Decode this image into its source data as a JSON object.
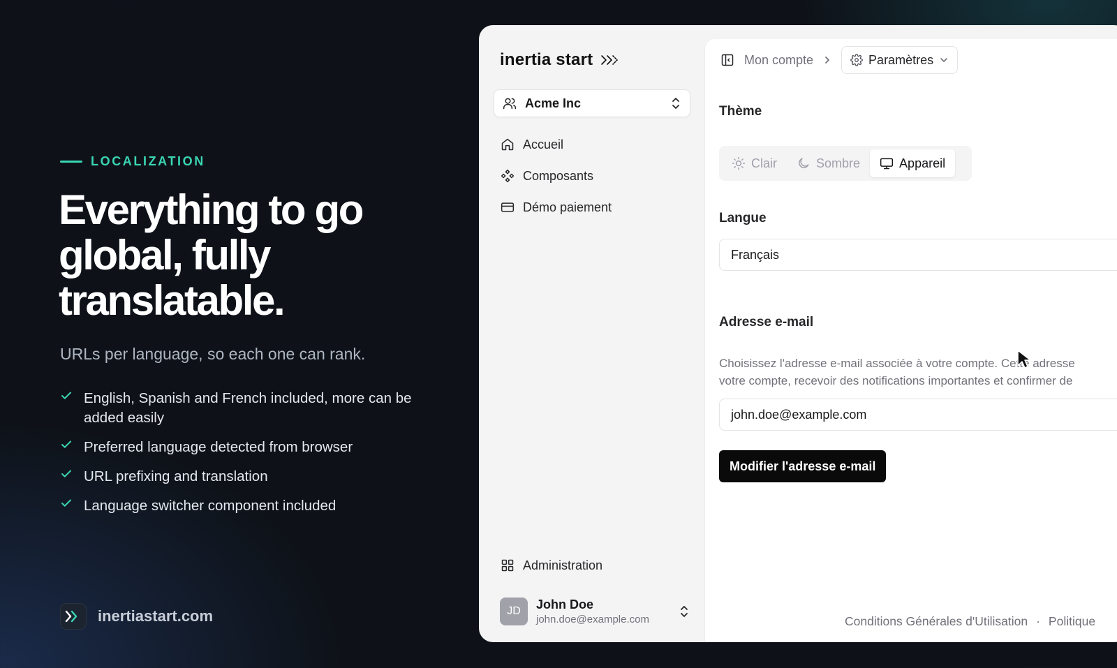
{
  "marketing": {
    "eyebrow": "LOCALIZATION",
    "headline": "Everything to go global, fully translatable.",
    "subline": "URLs per language, so each one can rank.",
    "features": [
      "English, Spanish and French included, more can be added easily",
      "Preferred language detected from browser",
      "URL prefixing and translation",
      "Language switcher component included"
    ],
    "site_url": "inertiastart.com",
    "accent_color": "#3ad6b3"
  },
  "app": {
    "brand": "inertia start",
    "team": "Acme Inc",
    "nav": [
      {
        "label": "Accueil",
        "icon": "home-icon"
      },
      {
        "label": "Composants",
        "icon": "components-icon"
      },
      {
        "label": "Démo paiement",
        "icon": "credit-card-icon"
      }
    ],
    "admin_label": "Administration",
    "user": {
      "initials": "JD",
      "name": "John Doe",
      "email": "john.doe@example.com"
    },
    "breadcrumb": {
      "parent": "Mon compte",
      "current": "Paramètres"
    },
    "theme": {
      "title": "Thème",
      "options": [
        "Clair",
        "Sombre",
        "Appareil"
      ],
      "selected": "Appareil"
    },
    "language": {
      "title": "Langue",
      "value": "Français"
    },
    "email": {
      "title": "Adresse e-mail",
      "description_line1": "Choisissez l'adresse e-mail associée à votre compte. Cette adresse",
      "description_line2": "votre compte, recevoir des notifications importantes et confirmer de",
      "value": "john.doe@example.com",
      "button": "Modifier l'adresse e-mail"
    },
    "footer": {
      "terms": "Conditions Générales d'Utilisation",
      "separator": "·",
      "privacy": "Politique"
    }
  }
}
